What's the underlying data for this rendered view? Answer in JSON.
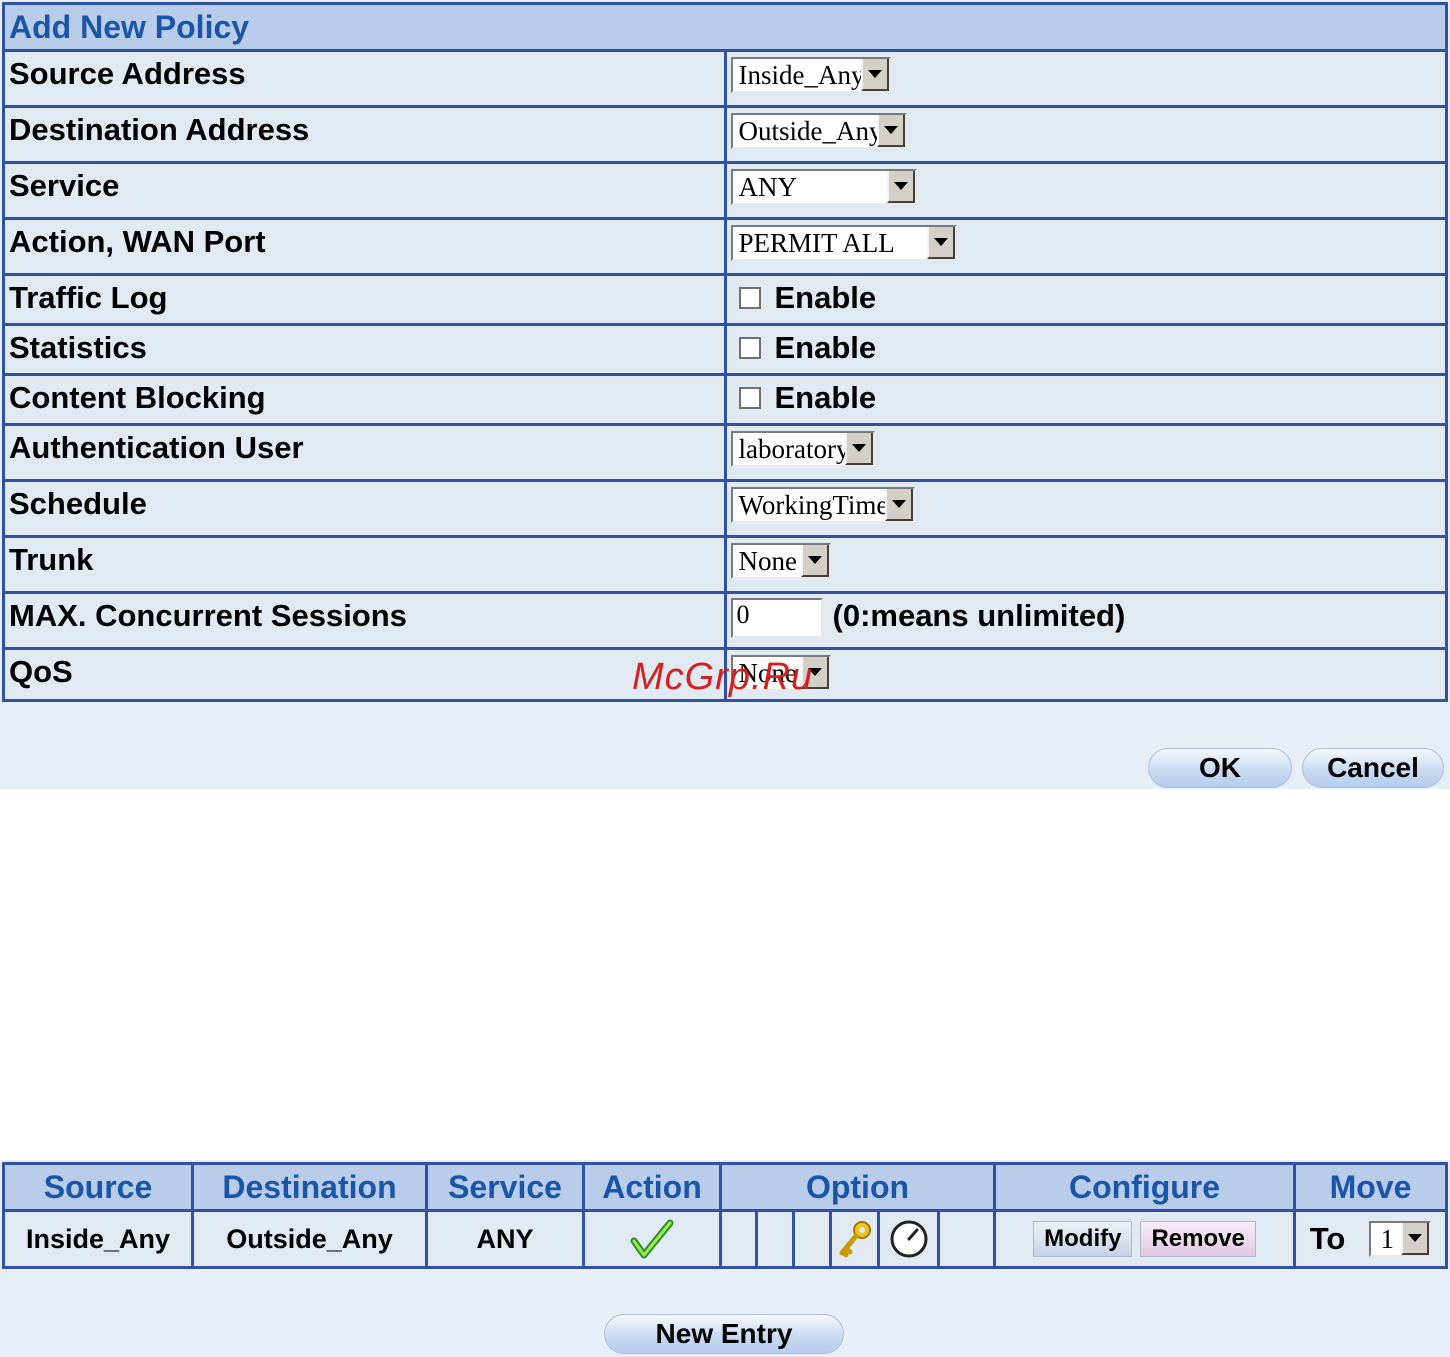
{
  "form": {
    "title": "Add New Policy",
    "rows": [
      {
        "label": "Source Address",
        "value": "Inside_Any"
      },
      {
        "label": "Destination Address",
        "value": "Outside_Any"
      },
      {
        "label": "Service",
        "value": "ANY"
      },
      {
        "label": "Action, WAN Port",
        "value": "PERMIT ALL"
      },
      {
        "label": "Traffic Log",
        "value": "Enable"
      },
      {
        "label": "Statistics",
        "value": "Enable"
      },
      {
        "label": "Content Blocking",
        "value": "Enable"
      },
      {
        "label": "Authentication User",
        "value": "laboratory"
      },
      {
        "label": "Schedule",
        "value": "WorkingTime"
      },
      {
        "label": "Trunk",
        "value": "None"
      },
      {
        "label": "MAX. Concurrent Sessions",
        "value": "0",
        "hint": "(0:means unlimited)"
      },
      {
        "label": "QoS",
        "value": "None"
      }
    ],
    "ok_label": "OK",
    "cancel_label": "Cancel"
  },
  "watermark": "McGrp.Ru",
  "list": {
    "headers": {
      "source": "Source",
      "destination": "Destination",
      "service": "Service",
      "action": "Action",
      "option": "Option",
      "configure": "Configure",
      "move": "Move"
    },
    "row": {
      "source": "Inside_Any",
      "destination": "Outside_Any",
      "service": "ANY",
      "action_icon": "checkmark-icon",
      "option_icons": [
        "key-icon",
        "clock-icon"
      ],
      "modify_label": "Modify",
      "remove_label": "Remove",
      "to_label": "To",
      "move_value": "1"
    },
    "new_entry_label": "New Entry"
  },
  "colors": {
    "border": "#2f52a2",
    "header_bg": "#b9cdeb",
    "header_text": "#1a56a8",
    "cell_bg": "#e1e9f3"
  }
}
